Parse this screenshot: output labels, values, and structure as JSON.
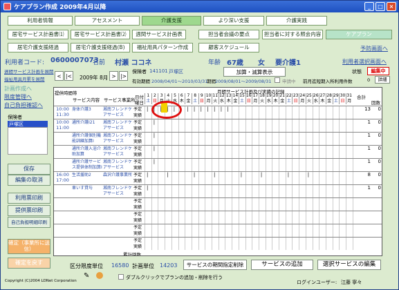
{
  "window": {
    "title": "ケアプラン作成 2009年4月以降",
    "min": "_",
    "max": "□",
    "close": "×"
  },
  "nav_row1": [
    "利用者情報",
    "アセスメント",
    "介護支援",
    "より深い支援",
    "介護実践"
  ],
  "nav_row2": [
    "居宅サービス計画書⑴",
    "居宅サービス計画書⑵",
    "週間サービス計画表",
    "担当者会議の要点",
    "担当者に対する照会内容",
    "ケアプラン"
  ],
  "nav_row3": [
    "居宅介護支援経過",
    "居宅介護支援経過(B)",
    "福祉用具パターン作成",
    "顧客スケジュール",
    "予防画面へ"
  ],
  "user": {
    "code_label": "利用者コード:",
    "code": "0600007073",
    "name_label": "名前",
    "name": "村瀬 ココネ",
    "age_label": "年齢",
    "age": "67歳",
    "sex": "女",
    "care": "要介護1",
    "select_link": "利用者選択画面へ"
  },
  "left_links": [
    "週間サービス計画を展開",
    "福祉用具月累を展開",
    "計画作成へ",
    "限度管理へ",
    "自己負担確認へ"
  ],
  "insurer_label": "保険者",
  "insurer_value": "戸塚区",
  "left_buttons": [
    "保存",
    "編集の取消",
    "利用票印刷",
    "提供票印刷",
    "自己負担明細印刷",
    "確定（事業所に送信）",
    "確定を戻す"
  ],
  "month": {
    "prev": "<",
    "label": "2009年 8月",
    "next": ">",
    "next2": "|>",
    "prev2": "|<"
  },
  "hoken": {
    "label": "保険者",
    "value": "141101",
    "ward": "戸塚区",
    "add_btn": "加算・減算表示",
    "status_label": "状態",
    "status": "編集中",
    "period_label": "有効期間",
    "period": "2008/04/01〜2010/03/31",
    "period2_label": "期間",
    "period2": "2009/08/01〜2009/08/31",
    "apply": "申請中",
    "prev_count_label": "前月迄短期入所利用件数",
    "prev_count": "0",
    "detail": "詳細"
  },
  "table": {
    "title": "月間サービス計画及び実績の記録",
    "h_time": "提供時間帯",
    "h_svc": "サービス内容",
    "h_prov": "サービス事業所",
    "h_day": "日付",
    "h_week": "曜日",
    "h_total": "合計",
    "h_count": "回数",
    "days": [
      "1",
      "2",
      "3",
      "4",
      "5",
      "6",
      "7",
      "8",
      "9",
      "10",
      "11",
      "12",
      "13",
      "14",
      "15",
      "16",
      "17",
      "18",
      "19",
      "20",
      "21",
      "22",
      "23",
      "24",
      "25",
      "26",
      "27",
      "28",
      "29",
      "30",
      "31"
    ],
    "weekdays": [
      "土",
      "日",
      "月",
      "火",
      "水",
      "木",
      "金",
      "土",
      "日",
      "月",
      "火",
      "水",
      "木",
      "金",
      "土",
      "日",
      "月",
      "火",
      "水",
      "木",
      "金",
      "土",
      "日",
      "月",
      "火",
      "水",
      "木",
      "金",
      "土",
      "日",
      "月"
    ],
    "rows": [
      {
        "time": "10:00 11:30",
        "svc": "身体介護3",
        "prov": "湘南フレンドケアサービス",
        "plan": "予定",
        "act": "実績",
        "total": "13",
        "zero": "0"
      },
      {
        "time": "10:00 11:00",
        "svc": "通所介護Ⅰ21",
        "prov": "湘南フレンドケアサービス",
        "plan": "予定",
        "act": "実績",
        "total": "1",
        "zero": "0"
      },
      {
        "time": "",
        "svc": "通所介護個別機能訓練加算Ⅰ",
        "prov": "湘南フレンドケアサービス",
        "plan": "予定",
        "act": "実績",
        "total": "1",
        "zero": "0"
      },
      {
        "time": "",
        "svc": "通所介護入浴介助加算",
        "prov": "湘南フレンドケアサービス",
        "plan": "予定",
        "act": "実績",
        "total": "1",
        "zero": "0"
      },
      {
        "time": "",
        "svc": "通所介護サービス提供体制加算Ⅰ",
        "prov": "湘南フレンドケアサービス",
        "plan": "予定",
        "act": "実績",
        "total": "1",
        "zero": "0"
      },
      {
        "time": "16:00 17:00",
        "svc": "生活援助2",
        "prov": "森沢介護事業所",
        "plan": "予定",
        "act": "実績",
        "total": "8",
        "zero": "0"
      },
      {
        "time": "",
        "svc": "車いす貸与",
        "prov": "湘南フレンドケアサービス",
        "plan": "予定",
        "act": "実績",
        "total": "1",
        "zero": "0"
      },
      {
        "time": "",
        "svc": "",
        "prov": "",
        "plan": "予定",
        "act": "実績",
        "total": "",
        "zero": ""
      },
      {
        "time": "",
        "svc": "",
        "prov": "",
        "plan": "予定",
        "act": "実績",
        "total": "",
        "zero": ""
      },
      {
        "time": "",
        "svc": "",
        "prov": "",
        "plan": "予定",
        "act": "実績",
        "total": "",
        "zero": ""
      },
      {
        "time": "",
        "svc": "",
        "prov": "",
        "plan": "予定",
        "act": "実績",
        "total": "",
        "zero": ""
      }
    ],
    "footer_label": "累計回数"
  },
  "bottom": {
    "limit_label": "区分限度単位",
    "limit": "16580",
    "plan_label": "計画単位",
    "plan": "14203",
    "b1": "サービスの期間指定削除",
    "b2": "サービスの追加",
    "b3": "選択サービスの編集",
    "hint": "ダブルクリックでプランの追加・削除を行う",
    "copyright": "Copyright (C)2004 LDNet Corporation",
    "login_label": "ログインユーザー:",
    "login_user": "江藤 寧々"
  }
}
